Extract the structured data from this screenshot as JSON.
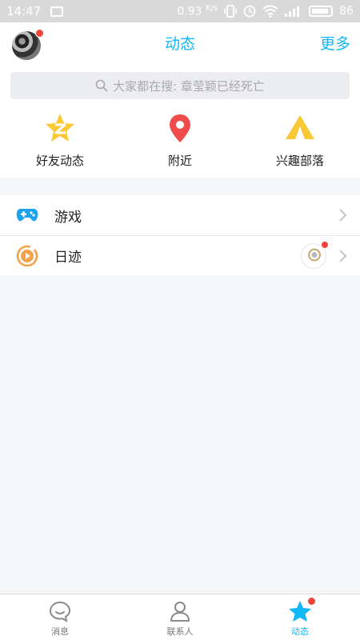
{
  "status_bar": {
    "time": "14:47",
    "speed": "0.93",
    "speed_unit": "K/s",
    "battery": "86"
  },
  "header": {
    "title": "动态",
    "more_label": "更多"
  },
  "search": {
    "placeholder": "大家都在搜: 章莹颖已经死亡"
  },
  "quick_actions": [
    {
      "label": "好友动态",
      "icon": "qzone-star-icon",
      "color": "#f9c935"
    },
    {
      "label": "附近",
      "icon": "location-pin-icon",
      "color": "#f04c4c"
    },
    {
      "label": "兴趣部落",
      "icon": "tent-icon",
      "color": "#f9c935"
    }
  ],
  "list": [
    {
      "label": "游戏",
      "icon": "gamepad-icon",
      "color": "#1aa2f0"
    },
    {
      "label": "日迹",
      "icon": "play-circle-icon",
      "color": "#f4a24a"
    }
  ],
  "tabs": [
    {
      "label": "消息",
      "icon": "chat-icon",
      "active": false
    },
    {
      "label": "联系人",
      "icon": "contact-icon",
      "active": false
    },
    {
      "label": "动态",
      "icon": "star-icon",
      "active": true
    }
  ],
  "colors": {
    "accent": "#12b7f5",
    "badge": "#f04437"
  }
}
